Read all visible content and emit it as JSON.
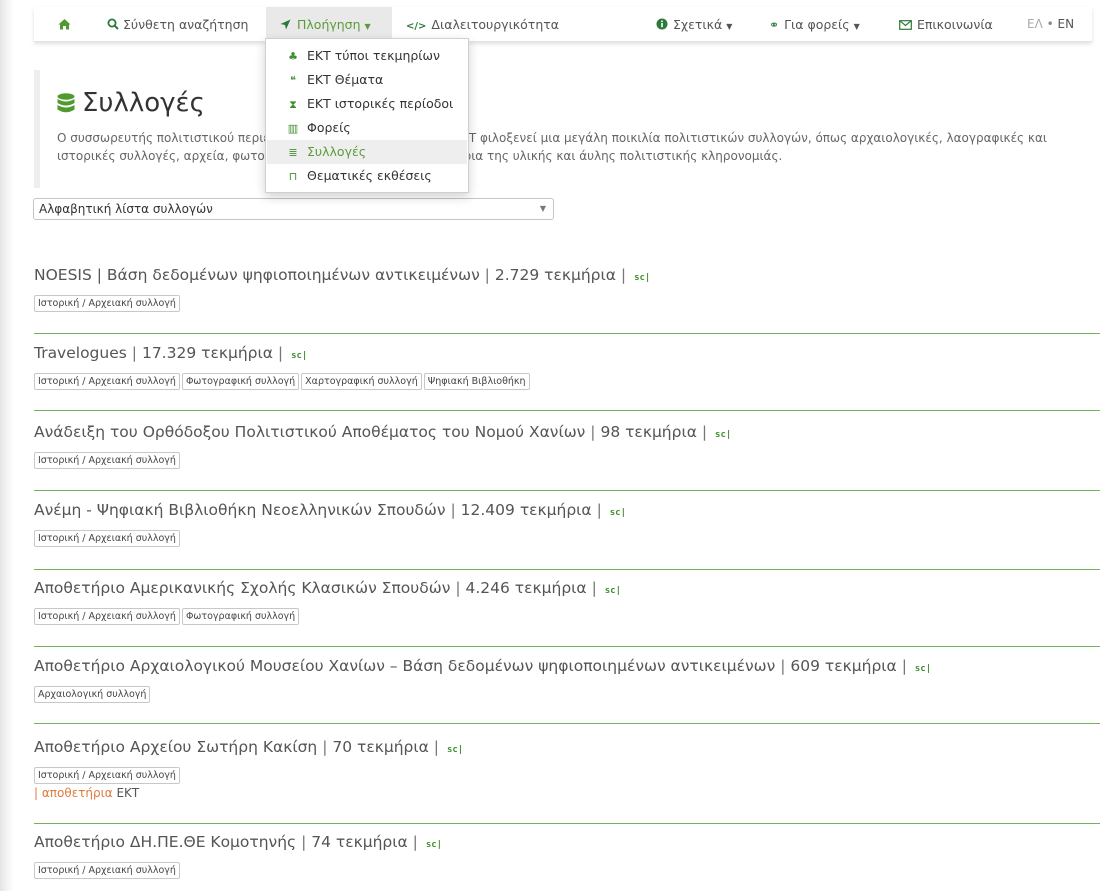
{
  "nav": {
    "home_icon": "home-icon",
    "search_label": "Σύνθετη αναζήτηση",
    "browse_label": "Πλοήγηση",
    "interop_label": "Διαλειτουργικότητα",
    "about_label": "Σχετικά",
    "providers_label": "Για φορείς",
    "contact_label": "Επικοινωνία",
    "lang_el": "ΕΛ",
    "lang_sep": "•",
    "lang_en": "EN"
  },
  "browse_menu": {
    "items": [
      {
        "label": "ΕΚΤ τύποι τεκμηρίων",
        "icon": "sitemap-icon",
        "glyph": "♣"
      },
      {
        "label": "ΕΚΤ Θέματα",
        "icon": "quote-icon",
        "glyph": "❝"
      },
      {
        "label": "ΕΚΤ ιστορικές περίοδοι",
        "icon": "hourglass-icon",
        "glyph": "⧗"
      },
      {
        "label": "Φορείς",
        "icon": "institution-icon",
        "glyph": "▥"
      },
      {
        "label": "Συλλογές",
        "icon": "database-icon",
        "glyph": "≣",
        "selected": true
      },
      {
        "label": "Θεματικές εκθέσεις",
        "icon": "bookmark-icon",
        "glyph": "⊓"
      }
    ]
  },
  "page": {
    "title": "Συλλογές",
    "intro_line1": "Ο συσσωρευτής πολιτιστικού περιεχομένου SearchCulture.gr του ΕΚΤ φιλοξενεί μια μεγάλη ποικιλία πολιτιστικών συλλογών, όπως αρχαιολογικές, λαογραφικές και",
    "intro_line2": "ιστορικές συλλογές, αρχεία, φωτογραφίες και άλλα ψηφιακά τεκμήρια της υλικής και άυλης πολιτιστικής κληρονομιάς.",
    "select_value": "Αλφαβητική λίστα συλλογών"
  },
  "collections": [
    {
      "name": "NOESIS | Βάση δεδομένων ψηφιοποιημένων αντικειμένων",
      "count": "2.729 τεκμήρια",
      "badge": "sc|",
      "tags": [
        "Ιστορική / Αρχειακή συλλογή"
      ]
    },
    {
      "name": "Travelogues",
      "count": "17.329 τεκμήρια",
      "badge": "sc|",
      "tags": [
        "Ιστορική / Αρχειακή συλλογή",
        "Φωτογραφική συλλογή",
        "Χαρτογραφική συλλογή",
        "Ψηφιακή Βιβλιοθήκη"
      ]
    },
    {
      "name": "Ανάδειξη του Ορθόδοξου Πολιτιστικού Αποθέματος του Νομού Χανίων",
      "count": "98 τεκμήρια",
      "badge": "sc|",
      "tags": [
        "Ιστορική / Αρχειακή συλλογή"
      ]
    },
    {
      "name": "Ανέμη - Ψηφιακή Βιβλιοθήκη Νεοελληνικών Σπουδών",
      "count": "12.409 τεκμήρια",
      "badge": "sc|",
      "tags": [
        "Ιστορική / Αρχειακή συλλογή"
      ]
    },
    {
      "name": "Αποθετήριο Αμερικανικής Σχολής Κλασικών Σπουδών",
      "count": "4.246 τεκμήρια",
      "badge": "sc|",
      "tags": [
        "Ιστορική / Αρχειακή συλλογή",
        "Φωτογραφική συλλογή"
      ]
    },
    {
      "name": "Αποθετήριο Αρχαιολογικού Μουσείου Χανίων – Βάση δεδομένων ψηφιοποιημένων αντικειμένων",
      "count": "609 τεκμήρια",
      "badge": "sc|",
      "tags": [
        "Αρχαιολογική συλλογή"
      ]
    },
    {
      "name": "Αποθετήριο Αρχείου Σωτήρη Κακίση",
      "count": "70 τεκμήρια",
      "badge": "sc|",
      "tags": [
        "Ιστορική / Αρχειακή συλλογή"
      ],
      "extra_sep": "|",
      "extra_link": "αποθετήρια",
      "extra_text": "ΕΚΤ"
    },
    {
      "name": "Αποθετήριο ΔΗ.ΠΕ.ΘΕ Κομοτηνής",
      "count": "74 τεκμήρια",
      "badge": "sc|",
      "tags": [
        "Ιστορική / Αρχειακή συλλογή"
      ]
    }
  ],
  "colors": {
    "accent": "#4f9b2f",
    "divider": "#6fb45a",
    "link_orange": "#e07b3c"
  }
}
